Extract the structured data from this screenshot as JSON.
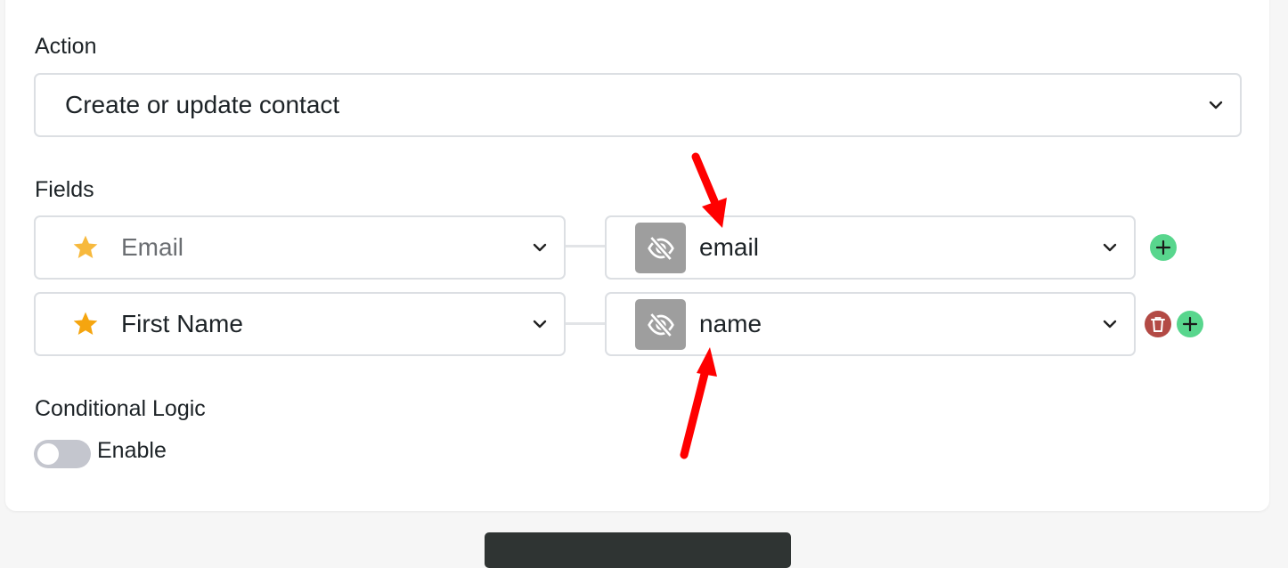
{
  "action": {
    "label": "Action",
    "selected": "Create or update contact"
  },
  "fields": {
    "label": "Fields",
    "rows": [
      {
        "field": "Email",
        "value": "email"
      },
      {
        "field": "First Name",
        "value": "name"
      }
    ]
  },
  "conditional": {
    "label": "Conditional Logic",
    "toggle_label": "Enable",
    "enabled": false
  },
  "icons": {
    "star": "star-icon",
    "hidden": "eye-slash-icon",
    "chevron": "chevron-down-icon",
    "add": "plus-icon",
    "delete": "trash-icon"
  },
  "colors": {
    "star": "#f5a623",
    "add": "#58d68d",
    "delete": "#b34a45",
    "annotation_arrow": "#ff0000"
  }
}
